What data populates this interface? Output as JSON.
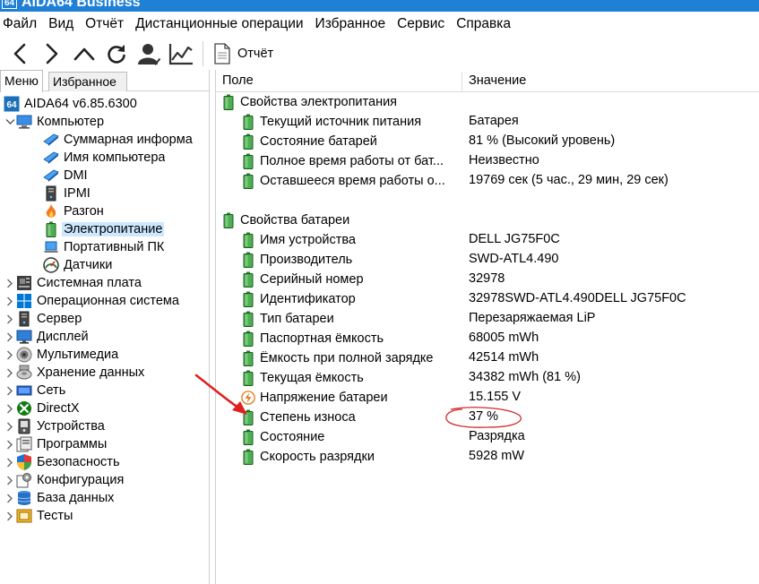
{
  "window": {
    "title": "AIDA64 Business",
    "logo": "64"
  },
  "menu": [
    "Файл",
    "Вид",
    "Отчёт",
    "Дистанционные операции",
    "Избранное",
    "Сервис",
    "Справка"
  ],
  "toolbar": {
    "buttons": [
      "back-icon",
      "forward-icon",
      "up-icon",
      "refresh-icon",
      "user-icon",
      "chart-icon"
    ],
    "report_label": "Отчёт"
  },
  "left_tabs": {
    "menu": "Меню",
    "favorites": "Избранное"
  },
  "tree": {
    "root": {
      "label": "AIDA64 v6.85.6300",
      "icon": "aida64-icon"
    },
    "computer": {
      "label": "Компьютер",
      "icon": "computer-icon"
    },
    "computer_children": [
      {
        "label": "Суммарная информа",
        "icon": "monitor-icon"
      },
      {
        "label": "Имя компьютера",
        "icon": "monitor-icon"
      },
      {
        "label": "DMI",
        "icon": "monitor-icon"
      },
      {
        "label": "IPMI",
        "icon": "server-icon"
      },
      {
        "label": "Разгон",
        "icon": "flame-icon"
      },
      {
        "label": "Электропитание",
        "icon": "battery-icon",
        "selected": true
      },
      {
        "label": "Портативный ПК",
        "icon": "laptop-icon"
      },
      {
        "label": "Датчики",
        "icon": "gauge-icon"
      }
    ],
    "top_items": [
      {
        "label": "Системная плата",
        "icon": "motherboard-icon"
      },
      {
        "label": "Операционная система",
        "icon": "windows-icon"
      },
      {
        "label": "Сервер",
        "icon": "server-icon"
      },
      {
        "label": "Дисплей",
        "icon": "display-icon"
      },
      {
        "label": "Мультимедиа",
        "icon": "speaker-icon"
      },
      {
        "label": "Хранение данных",
        "icon": "disk-icon"
      },
      {
        "label": "Сеть",
        "icon": "network-icon"
      },
      {
        "label": "DirectX",
        "icon": "xbox-icon"
      },
      {
        "label": "Устройства",
        "icon": "devices-icon"
      },
      {
        "label": "Программы",
        "icon": "programs-icon"
      },
      {
        "label": "Безопасность",
        "icon": "shield-icon"
      },
      {
        "label": "Конфигурация",
        "icon": "config-icon"
      },
      {
        "label": "База данных",
        "icon": "database-icon"
      },
      {
        "label": "Тесты",
        "icon": "benchmark-icon"
      }
    ]
  },
  "columns": {
    "field": "Поле",
    "value": "Значение"
  },
  "power_group": {
    "title": "Свойства электропитания",
    "rows": [
      {
        "field": "Текущий источник питания",
        "value": "Батарея",
        "icon": "battery-icon"
      },
      {
        "field": "Состояние батарей",
        "value": "81 % (Высокий уровень)",
        "icon": "battery-icon"
      },
      {
        "field": "Полное время работы от бат...",
        "value": "Неизвестно",
        "icon": "battery-icon"
      },
      {
        "field": "Оставшееся время работы о...",
        "value": "19769 сек (5 час., 29 мин, 29 сек)",
        "icon": "battery-icon"
      }
    ]
  },
  "battery_group": {
    "title": "Свойства батареи",
    "rows": [
      {
        "field": "Имя устройства",
        "value": "DELL JG75F0C",
        "icon": "battery-icon"
      },
      {
        "field": "Производитель",
        "value": "SWD-ATL4.490",
        "icon": "battery-icon"
      },
      {
        "field": "Серийный номер",
        "value": "32978",
        "icon": "battery-icon"
      },
      {
        "field": "Идентификатор",
        "value": "32978SWD-ATL4.490DELL JG75F0C",
        "icon": "battery-icon"
      },
      {
        "field": "Тип батареи",
        "value": "Перезаряжаемая LiP",
        "icon": "battery-icon"
      },
      {
        "field": "Паспортная ёмкость",
        "value": "68005 mWh",
        "icon": "battery-icon"
      },
      {
        "field": "Ёмкость при полной зарядке",
        "value": "42514 mWh",
        "icon": "battery-icon"
      },
      {
        "field": "Текущая ёмкость",
        "value": "34382 mWh  (81 %)",
        "icon": "battery-icon"
      },
      {
        "field": "Напряжение батареи",
        "value": "15.155 V",
        "icon": "voltage-icon"
      },
      {
        "field": "Степень износа",
        "value": "37 %",
        "icon": "battery-icon"
      },
      {
        "field": "Состояние",
        "value": "Разрядка",
        "icon": "battery-icon"
      },
      {
        "field": "Скорость разрядки",
        "value": "5928 mW",
        "icon": "battery-icon"
      }
    ]
  },
  "colors": {
    "titlebar": "#1f80d6",
    "selection": "#cce8ff",
    "annotation": "#e02020"
  }
}
